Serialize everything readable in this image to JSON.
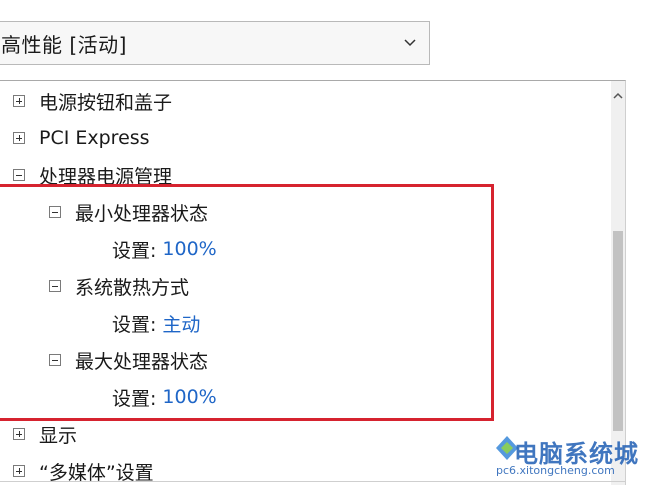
{
  "plan": {
    "selected": "高性能 [活动]"
  },
  "tree": {
    "items": [
      {
        "label": "电源按钮和盖子",
        "state": "collapsed"
      },
      {
        "label": "PCI Express",
        "state": "collapsed"
      },
      {
        "label": "处理器电源管理",
        "state": "expanded",
        "children": [
          {
            "label": "最小处理器状态",
            "setting_label": "设置:",
            "setting_value": "100%"
          },
          {
            "label": "系统散热方式",
            "setting_label": "设置:",
            "setting_value": "主动"
          },
          {
            "label": "最大处理器状态",
            "setting_label": "设置:",
            "setting_value": "100%"
          }
        ]
      },
      {
        "label": "显示",
        "state": "collapsed"
      },
      {
        "label": "“多媒体”设置",
        "state": "collapsed"
      }
    ]
  },
  "watermark": {
    "text": "电脑系统城",
    "url": "pc6.xitongcheng.com"
  },
  "colors": {
    "highlight": "#d6232f",
    "value_link": "#1f66c7",
    "watermark": "#1f5fb5"
  }
}
